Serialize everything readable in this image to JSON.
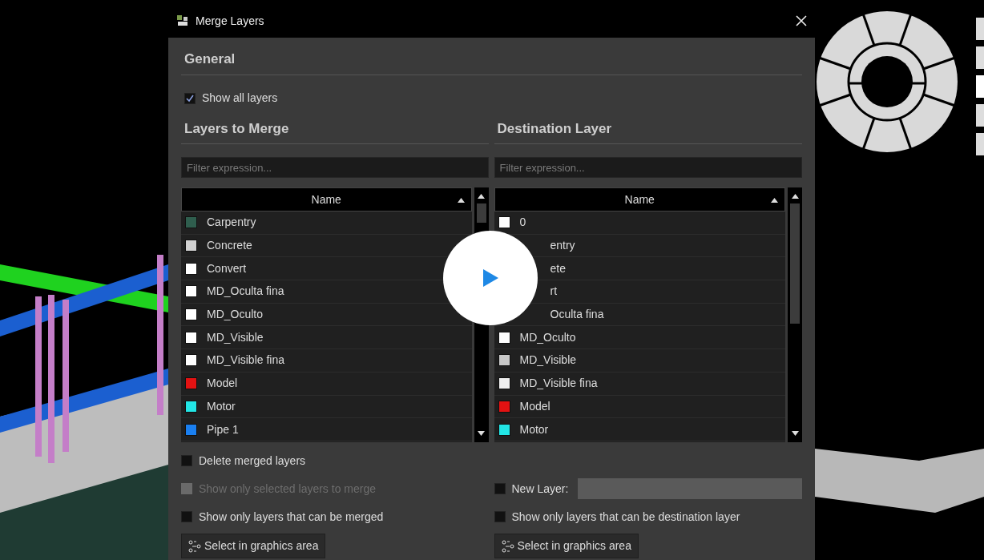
{
  "window": {
    "title": "Merge Layers"
  },
  "general": {
    "heading": "General",
    "show_all_layers": {
      "label": "Show all layers",
      "checked": true
    }
  },
  "layers_to_merge": {
    "heading": "Layers to Merge",
    "filter": {
      "placeholder": "Filter expression..."
    },
    "column": "Name",
    "rows": [
      {
        "name": "Carpentry",
        "color": "#2f5e4e"
      },
      {
        "name": "Concrete",
        "color": "#d2d2d2"
      },
      {
        "name": "Convert",
        "color": "#ffffff"
      },
      {
        "name": "MD_Oculta fina",
        "color": "#ffffff"
      },
      {
        "name": "MD_Oculto",
        "color": "#ffffff"
      },
      {
        "name": "MD_Visible",
        "color": "#ffffff"
      },
      {
        "name": "MD_Visible fina",
        "color": "#ffffff"
      },
      {
        "name": "Model",
        "color": "#e31212"
      },
      {
        "name": "Motor",
        "color": "#22e5e5"
      },
      {
        "name": "Pipe 1",
        "color": "#1a7ff0"
      }
    ],
    "options": [
      {
        "label": "Delete merged layers",
        "checked": false,
        "disabled": false
      },
      {
        "label": "Show only selected layers to merge",
        "checked": false,
        "disabled": true
      },
      {
        "label": "Show only layers that can be merged",
        "checked": false,
        "disabled": false
      }
    ],
    "button": "Select in graphics area"
  },
  "destination_layer": {
    "heading": "Destination Layer",
    "filter": {
      "placeholder": "Filter expression..."
    },
    "column": "Name",
    "rows": [
      {
        "name": "0",
        "color": "#ffffff",
        "kind": "full"
      },
      {
        "name": "entry",
        "kind": "partly-hidden"
      },
      {
        "name": "ete",
        "kind": "partly-hidden"
      },
      {
        "name": "rt",
        "kind": "partly-hidden"
      },
      {
        "name": "Oculta fina",
        "kind": "partly-hidden"
      },
      {
        "name": "MD_Oculto",
        "color": "#ffffff",
        "kind": "full"
      },
      {
        "name": "MD_Visible",
        "color": "#c8c8c8",
        "kind": "full"
      },
      {
        "name": "MD_Visible fina",
        "color": "#eeeeee",
        "kind": "full"
      },
      {
        "name": "Model",
        "color": "#e31212",
        "kind": "full"
      },
      {
        "name": "Motor",
        "color": "#22e5e5",
        "kind": "full"
      }
    ],
    "new_layer": {
      "label": "New Layer:",
      "checked": false
    },
    "options": [
      {
        "label": "Show only layers that can be destination layer",
        "checked": false,
        "disabled": false
      }
    ],
    "button": "Select in graphics area"
  }
}
